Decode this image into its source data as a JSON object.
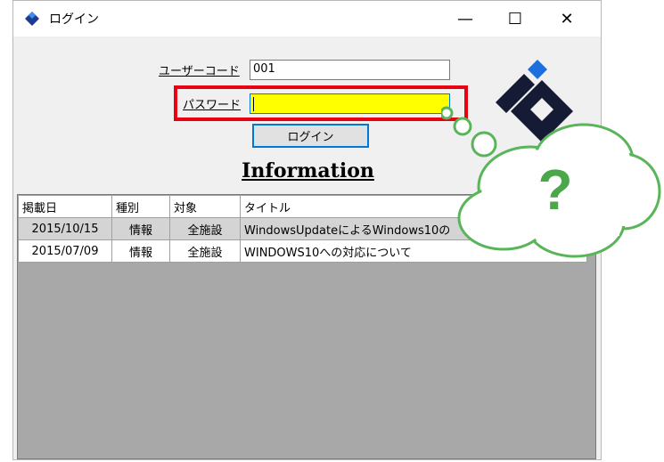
{
  "window": {
    "title": "ログイン",
    "minimize_glyph": "—",
    "maximize_glyph": "☐",
    "close_glyph": "✕"
  },
  "form": {
    "user_code_label": "ユーザーコード",
    "user_code_value": "001",
    "password_label": "パスワード",
    "password_value": "",
    "login_button": "ログイン"
  },
  "information_title": "Information",
  "table": {
    "columns": [
      "掲載日",
      "種別",
      "対象",
      "タイトル"
    ],
    "rows": [
      [
        "2015/10/15",
        "情報",
        "全施設",
        "WindowsUpdateによるWindows10の"
      ],
      [
        "2015/07/09",
        "情報",
        "全施設",
        "WINDOWS10への対応について"
      ]
    ]
  },
  "callout": {
    "text": "?"
  },
  "colors": {
    "highlight": "#e60012",
    "password_bg": "#ffff00",
    "cloud_fill": "#ffffff",
    "cloud_stroke": "#5ab55a",
    "logo_blue": "#1d6fe0"
  },
  "icons": [
    "app-logo-icon",
    "minimize-icon",
    "maximize-icon",
    "close-icon"
  ]
}
